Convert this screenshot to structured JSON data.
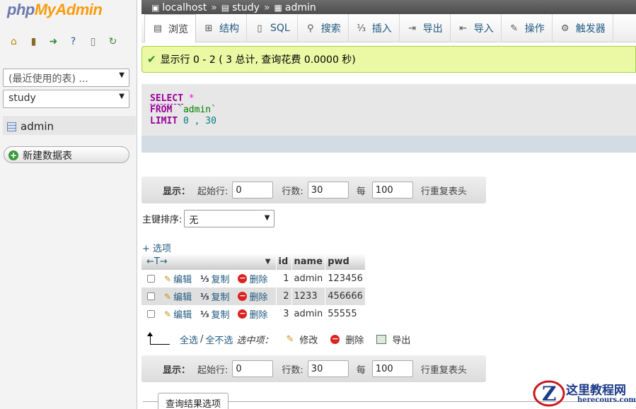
{
  "nav": {
    "logo_php": "php",
    "logo_myadmin": "MyAdmin",
    "icons": [
      "home-icon",
      "logout-icon",
      "sql-query-icon",
      "help-icon",
      "docs-icon",
      "reload-icon"
    ],
    "recent_label": "(最近使用的表) ...",
    "db_selected": "study",
    "table_item": "admin",
    "new_table_label": "新建数据表"
  },
  "breadcrumb": {
    "server": "localhost",
    "sep1": "»",
    "database": "study",
    "sep2": "»",
    "table": "admin"
  },
  "tabs": [
    {
      "label": "浏览",
      "icon": "browse-icon",
      "active": true
    },
    {
      "label": "结构",
      "icon": "structure-icon"
    },
    {
      "label": "SQL",
      "icon": "sql-icon"
    },
    {
      "label": "搜索",
      "icon": "search-icon"
    },
    {
      "label": "插入",
      "icon": "insert-icon"
    },
    {
      "label": "导出",
      "icon": "export-icon"
    },
    {
      "label": "导入",
      "icon": "import-icon"
    },
    {
      "label": "操作",
      "icon": "wrench-icon"
    },
    {
      "label": "触发器",
      "icon": "trigger-icon"
    }
  ],
  "success_message": "显示行 0 - 2 ( 3 总计, 查询花费 0.0000 秒)",
  "sql": {
    "select_kw": "SELECT",
    "star": "*",
    "from_kw": "FROM",
    "table": "`admin`",
    "limit_kw": "LIMIT",
    "offset": "0",
    "comma": ",",
    "count": "30"
  },
  "navform": {
    "show_label": "显示：",
    "start_label": "起始行:",
    "start_value": "0",
    "rows_label": "行数:",
    "rows_value": "30",
    "every_label": "每",
    "every_value": "100",
    "repeat_label": "行重复表头"
  },
  "sort": {
    "label": "主键排序:",
    "value": "无"
  },
  "options_link": "+ 选项",
  "table": {
    "col_control": "←T→",
    "headers": [
      "id",
      "name",
      "pwd"
    ],
    "actions": {
      "edit": "编辑",
      "copy": "复制",
      "delete": "删除"
    },
    "rows": [
      {
        "id": "1",
        "name": "admin",
        "pwd": "123456"
      },
      {
        "id": "2",
        "name": "1233",
        "pwd": "456666"
      },
      {
        "id": "3",
        "name": "admin",
        "pwd": "55555"
      }
    ]
  },
  "with_selected": {
    "check_all": "全选",
    "slash": "/",
    "uncheck_all": "全不选",
    "label": "选中项：",
    "modify": "修改",
    "delete": "删除",
    "export": "导出"
  },
  "footer": {
    "query_results_options": "查询结果选项"
  },
  "watermark": {
    "title": "这里教程网",
    "url": "herecours.com"
  }
}
